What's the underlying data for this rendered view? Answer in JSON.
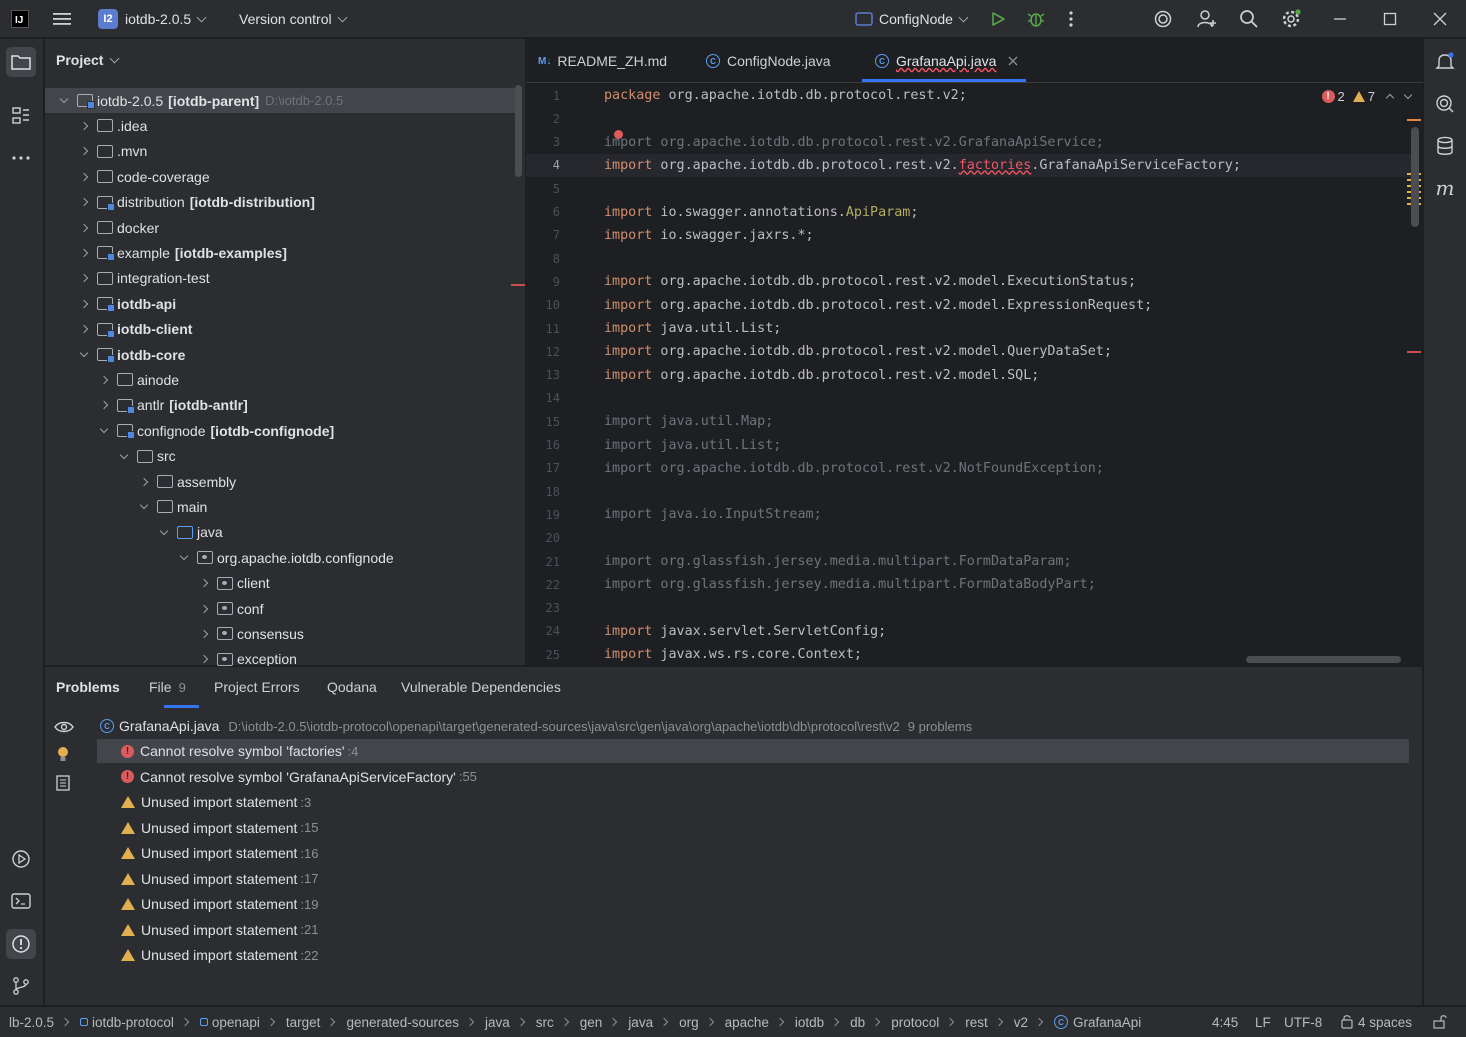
{
  "titlebar": {
    "app_logo": "IJ",
    "project_badge": "I2",
    "project_name": "iotdb-2.0.5",
    "vcs_label": "Version control",
    "run_config": "ConfigNode"
  },
  "project_panel": {
    "title": "Project",
    "tree": [
      {
        "name": "iotdb-2.0.5",
        "module": "[iotdb-parent]",
        "path": "D:\\iotdb-2.0.5",
        "depth": 0,
        "expanded": true,
        "bold": false
      },
      {
        "name": ".idea",
        "module": "",
        "depth": 1,
        "expanded": false
      },
      {
        "name": ".mvn",
        "module": "",
        "depth": 1,
        "expanded": false
      },
      {
        "name": "code-coverage",
        "module": "",
        "depth": 1,
        "expanded": false
      },
      {
        "name": "distribution",
        "module": "[iotdb-distribution]",
        "depth": 1,
        "expanded": false
      },
      {
        "name": "docker",
        "module": "",
        "depth": 1,
        "expanded": false
      },
      {
        "name": "example",
        "module": "[iotdb-examples]",
        "depth": 1,
        "expanded": false
      },
      {
        "name": "integration-test",
        "module": "",
        "depth": 1,
        "expanded": false
      },
      {
        "name": "iotdb-api",
        "module": "",
        "depth": 1,
        "expanded": false,
        "bold": true
      },
      {
        "name": "iotdb-client",
        "module": "",
        "depth": 1,
        "expanded": false,
        "bold": true
      },
      {
        "name": "iotdb-core",
        "module": "",
        "depth": 1,
        "expanded": true,
        "bold": true
      },
      {
        "name": "ainode",
        "module": "",
        "depth": 2,
        "expanded": false
      },
      {
        "name": "antlr",
        "module": "[iotdb-antlr]",
        "depth": 2,
        "expanded": false
      },
      {
        "name": "confignode",
        "module": "[iotdb-confignode]",
        "depth": 2,
        "expanded": true
      },
      {
        "name": "src",
        "module": "",
        "depth": 3,
        "expanded": true
      },
      {
        "name": "assembly",
        "module": "",
        "depth": 4,
        "expanded": false
      },
      {
        "name": "main",
        "module": "",
        "depth": 4,
        "expanded": true
      },
      {
        "name": "java",
        "module": "",
        "depth": 5,
        "expanded": true
      },
      {
        "name": "org.apache.iotdb.confignode",
        "module": "",
        "depth": 6,
        "expanded": true
      },
      {
        "name": "client",
        "module": "",
        "depth": 7,
        "expanded": false
      },
      {
        "name": "conf",
        "module": "",
        "depth": 7,
        "expanded": false
      },
      {
        "name": "consensus",
        "module": "",
        "depth": 7,
        "expanded": false
      },
      {
        "name": "exception",
        "module": "",
        "depth": 7,
        "expanded": false
      }
    ]
  },
  "editor": {
    "tabs": [
      {
        "label": "README_ZH.md",
        "icon": "markdown-icon"
      },
      {
        "label": "ConfigNode.java",
        "icon": "class-icon"
      },
      {
        "label": "GrafanaApi.java",
        "icon": "class-icon",
        "active": true
      }
    ],
    "inspection": {
      "errors": "2",
      "warnings": "7"
    },
    "lines": [
      {
        "n": "1",
        "kw": "package",
        "text": " org.apache.iotdb.db.protocol.rest.v2;",
        "dim": false
      },
      {
        "n": "2",
        "kw": "",
        "text": "",
        "dim": false
      },
      {
        "n": "3",
        "kw": "import",
        "text": " org.apache.iotdb.db.protocol.rest.v2.GrafanaApiService;",
        "dim": true
      },
      {
        "n": "4",
        "kw": "import",
        "pre": " org.apache.iotdb.db.protocol.rest.v2.",
        "err": "factories",
        "text": ".GrafanaApiServiceFactory;",
        "dim": false,
        "current": true
      },
      {
        "n": "5",
        "kw": "",
        "text": "",
        "dim": false
      },
      {
        "n": "6",
        "kw": "import",
        "pre": " io.swagger.annotations.",
        "ann": "ApiParam",
        "text": ";",
        "dim": false
      },
      {
        "n": "7",
        "kw": "import",
        "text": " io.swagger.jaxrs.*;",
        "dim": false
      },
      {
        "n": "8",
        "kw": "",
        "text": "",
        "dim": false
      },
      {
        "n": "9",
        "kw": "import",
        "text": " org.apache.iotdb.db.protocol.rest.v2.model.ExecutionStatus;",
        "dim": false
      },
      {
        "n": "10",
        "kw": "import",
        "text": " org.apache.iotdb.db.protocol.rest.v2.model.ExpressionRequest;",
        "dim": false
      },
      {
        "n": "11",
        "kw": "import",
        "text": " java.util.List;",
        "dim": false
      },
      {
        "n": "12",
        "kw": "import",
        "text": " org.apache.iotdb.db.protocol.rest.v2.model.QueryDataSet;",
        "dim": false
      },
      {
        "n": "13",
        "kw": "import",
        "text": " org.apache.iotdb.db.protocol.rest.v2.model.SQL;",
        "dim": false
      },
      {
        "n": "14",
        "kw": "",
        "text": "",
        "dim": false
      },
      {
        "n": "15",
        "kw": "import",
        "text": " java.util.Map;",
        "dim": true
      },
      {
        "n": "16",
        "kw": "import",
        "text": " java.util.List;",
        "dim": true
      },
      {
        "n": "17",
        "kw": "import",
        "text": " org.apache.iotdb.db.protocol.rest.v2.NotFoundException;",
        "dim": true
      },
      {
        "n": "18",
        "kw": "",
        "text": "",
        "dim": false
      },
      {
        "n": "19",
        "kw": "import",
        "text": " java.io.InputStream;",
        "dim": true
      },
      {
        "n": "20",
        "kw": "",
        "text": "",
        "dim": false
      },
      {
        "n": "21",
        "kw": "import",
        "text": " org.glassfish.jersey.media.multipart.FormDataParam;",
        "dim": true
      },
      {
        "n": "22",
        "kw": "import",
        "text": " org.glassfish.jersey.media.multipart.FormDataBodyPart;",
        "dim": true
      },
      {
        "n": "23",
        "kw": "",
        "text": "",
        "dim": false
      },
      {
        "n": "24",
        "kw": "import",
        "text": " javax.servlet.ServletConfig;",
        "dim": false
      },
      {
        "n": "25",
        "kw": "import",
        "text": " javax.ws.rs.core.Context;",
        "dim": false
      }
    ]
  },
  "problems": {
    "tabs": [
      {
        "label": "Problems",
        "active": true
      },
      {
        "label": "File",
        "count": "9"
      },
      {
        "label": "Project Errors"
      },
      {
        "label": "Qodana"
      },
      {
        "label": "Vulnerable Dependencies"
      }
    ],
    "file": {
      "name": "GrafanaApi.java",
      "path": "D:\\iotdb-2.0.5\\iotdb-protocol\\openapi\\target\\generated-sources\\java\\src\\gen\\java\\org\\apache\\iotdb\\db\\protocol\\rest\\v2",
      "count": "9 problems"
    },
    "items": [
      {
        "type": "error",
        "text": "Cannot resolve symbol 'factories'",
        "line": ":4",
        "selected": true
      },
      {
        "type": "error",
        "text": "Cannot resolve symbol 'GrafanaApiServiceFactory'",
        "line": ":55"
      },
      {
        "type": "warning",
        "text": "Unused import statement",
        "line": ":3"
      },
      {
        "type": "warning",
        "text": "Unused import statement",
        "line": ":15"
      },
      {
        "type": "warning",
        "text": "Unused import statement",
        "line": ":16"
      },
      {
        "type": "warning",
        "text": "Unused import statement",
        "line": ":17"
      },
      {
        "type": "warning",
        "text": "Unused import statement",
        "line": ":19"
      },
      {
        "type": "warning",
        "text": "Unused import statement",
        "line": ":21"
      },
      {
        "type": "warning",
        "text": "Unused import statement",
        "line": ":22"
      }
    ]
  },
  "statusbar": {
    "breadcrumbs": [
      "lb-2.0.5",
      "iotdb-protocol",
      "openapi",
      "target",
      "generated-sources",
      "java",
      "src",
      "gen",
      "java",
      "org",
      "apache",
      "iotdb",
      "db",
      "protocol",
      "rest",
      "v2",
      "GrafanaApi"
    ],
    "position": "4:45",
    "line_sep": "LF",
    "encoding": "UTF-8",
    "indent": "4 spaces"
  }
}
